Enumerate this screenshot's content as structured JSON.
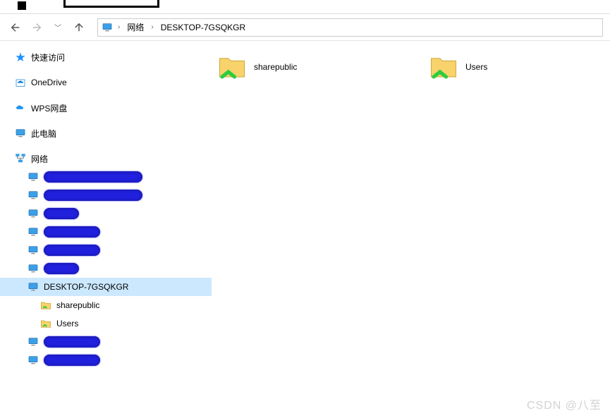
{
  "breadcrumb": {
    "network": "网络",
    "host": "DESKTOP-7GSQKGR"
  },
  "sidebar": {
    "quickaccess": "快速访问",
    "onedrive": "OneDrive",
    "wpscloud": "WPS网盘",
    "thispc": "此电脑",
    "network": "网络",
    "selected_host": "DESKTOP-7GSQKGR",
    "share1": "sharepublic",
    "share2": "Users"
  },
  "items": {
    "share1": "sharepublic",
    "share2": "Users"
  },
  "watermark": "CSDN @八至"
}
